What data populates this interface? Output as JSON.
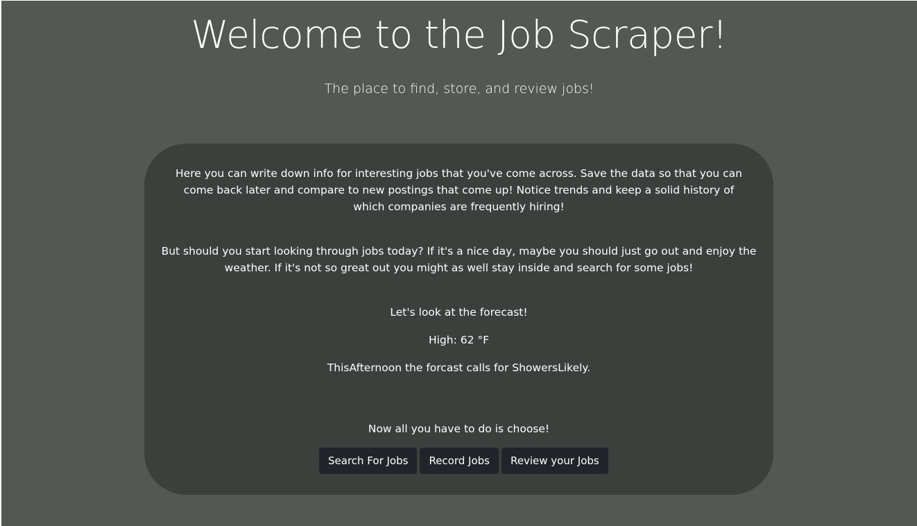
{
  "header": {
    "title": "Welcome to the Job Scraper!",
    "subtitle": "The place to find, store, and review jobs!"
  },
  "panel": {
    "intro": "Here you can write down info for interesting jobs that you've come across. Save the data so that you can come back later and compare to new postings that come up! Notice trends and keep a solid history of which companies are frequently hiring!",
    "weather_prompt": "But should you start looking through jobs today? If it's a nice day, maybe you should just go out and enjoy the weather. If it's not so great out you might as well stay inside and search for some jobs!",
    "forecast_heading": "Let's look at the forecast!",
    "forecast_high": "High: 62 °F",
    "forecast_summary": "ThisAfternoon the forcast calls for ShowersLikely.",
    "choose_prompt": "Now all you have to do is choose!",
    "buttons": {
      "search": "Search For Jobs",
      "record": "Record Jobs",
      "review": "Review your Jobs"
    }
  },
  "colors": {
    "background": "#535852",
    "panel": "#3c403d",
    "button": "#212429",
    "text": "#ffffff"
  }
}
